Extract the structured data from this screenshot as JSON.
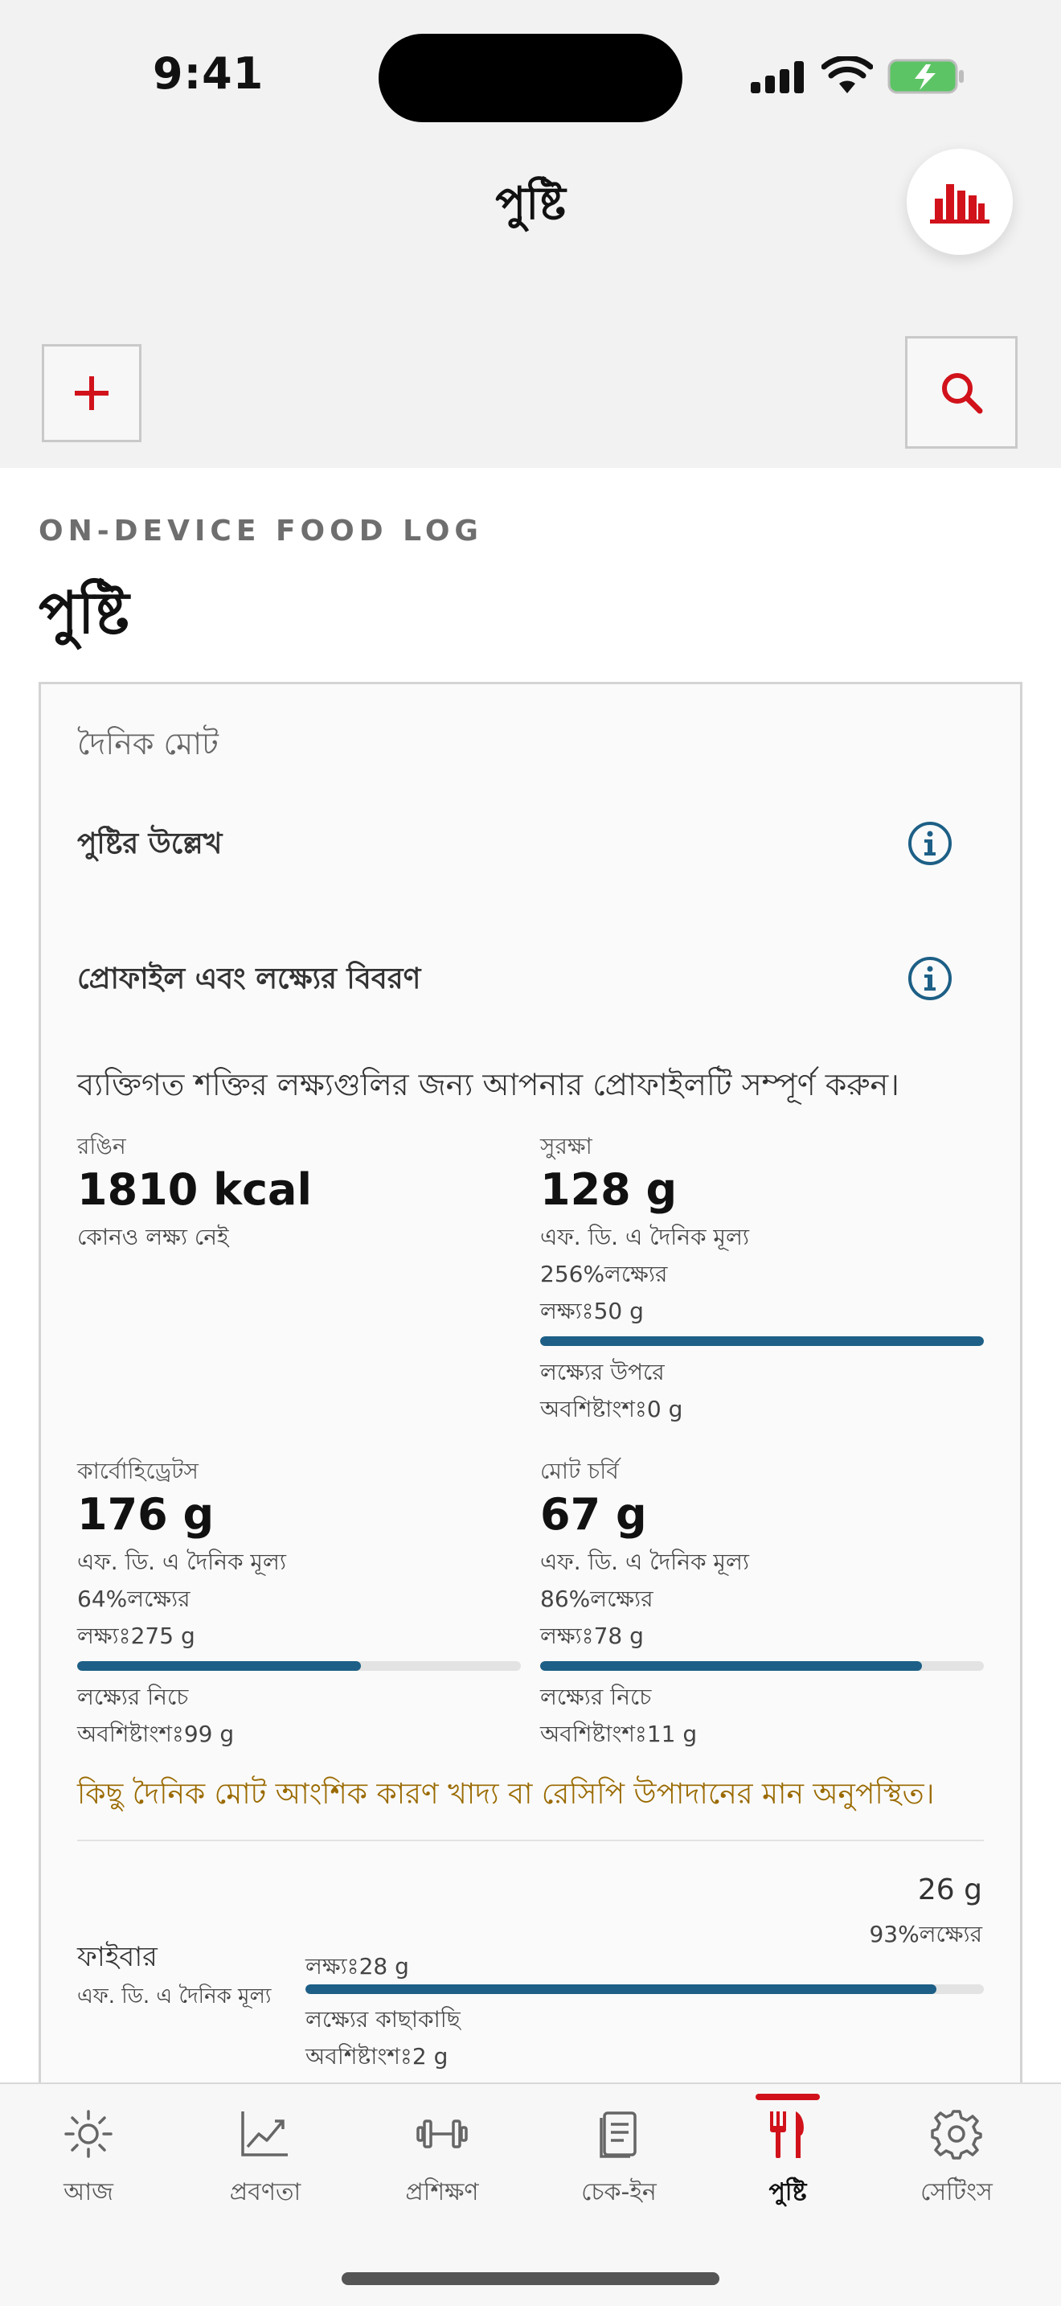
{
  "status_bar": {
    "time": "9:41"
  },
  "header": {
    "title": "পুষ্টি",
    "stats_icon": "bar-chart-icon",
    "add_icon": "plus-icon",
    "search_icon": "search-icon"
  },
  "page": {
    "eyebrow": "ON-DEVICE FOOD LOG",
    "title": "পুষ্টি"
  },
  "card": {
    "heading": "দৈনিক মোট",
    "rows": [
      {
        "label": "পুষ্টির উল্লেখ",
        "icon": "info-icon"
      },
      {
        "label": "প্রোফাইল এবং লক্ষ্যের বিবরণ",
        "icon": "info-icon"
      }
    ],
    "profile_note": "ব্যক্তিগত শক্তির লক্ষ্যগুলির জন্য আপনার প্রোফাইলটি সম্পূর্ণ করুন।",
    "metrics": {
      "energy": {
        "label": "রঙিন",
        "value": "1810 kcal",
        "note": "কোনও লক্ষ্য নেই"
      },
      "protein": {
        "label": "সুরক্ষা",
        "value": "128 g",
        "dv": "এফ. ডি. এ দৈনিক মূল্য",
        "pct": "256%লক্ষ্যের",
        "target": "লক্ষ্যঃ50 g",
        "progress_fraction": 1.0,
        "status": "লক্ষ্যের উপরে",
        "remaining": "অবশিষ্টাংশঃ0 g"
      },
      "carbs": {
        "label": "কার্বোহিড্রেটস",
        "value": "176 g",
        "dv": "এফ. ডি. এ দৈনিক মূল্য",
        "pct": "64%লক্ষ্যের",
        "target": "লক্ষ্যঃ275 g",
        "progress_fraction": 0.64,
        "status": "লক্ষ্যের নিচে",
        "remaining": "অবশিষ্টাংশঃ99 g"
      },
      "fat": {
        "label": "মোট চর্বি",
        "value": "67 g",
        "dv": "এফ. ডি. এ দৈনিক মূল্য",
        "pct": "86%লক্ষ্যের",
        "target": "লক্ষ্যঃ78 g",
        "progress_fraction": 0.86,
        "status": "লক্ষ্যের নিচে",
        "remaining": "অবশিষ্টাংশঃ11 g"
      }
    },
    "warning": "কিছু দৈনিক মোট আংশিক কারণ খাদ্য বা রেসিপি উপাদানের মান অনুপস্থিত।",
    "fiber": {
      "label": "ফাইবার",
      "dv": "এফ. ডি. এ দৈনিক মূল্য",
      "amount": "26 g",
      "pct": "93%লক্ষ্যের",
      "target": "লক্ষ্যঃ28 g",
      "progress_fraction": 0.93,
      "status": "লক্ষ্যের কাছাকাছি",
      "remaining": "অবশিষ্টাংশঃ2 g"
    }
  },
  "tabs": [
    {
      "label": "আজ",
      "icon": "sun-icon",
      "active": false
    },
    {
      "label": "প্রবণতা",
      "icon": "trend-icon",
      "active": false
    },
    {
      "label": "প্রশিক্ষণ",
      "icon": "dumbbell-icon",
      "active": false
    },
    {
      "label": "চেক-ইন",
      "icon": "clipboard-icon",
      "active": false
    },
    {
      "label": "পুষ্টি",
      "icon": "fork-knife-icon",
      "active": true
    },
    {
      "label": "সেটিংস",
      "icon": "gear-icon",
      "active": false
    }
  ],
  "colors": {
    "accent_red": "#d1121b",
    "progress_blue": "#1d5f86",
    "info_blue": "#1d5f86",
    "warning": "#9a6a00"
  }
}
